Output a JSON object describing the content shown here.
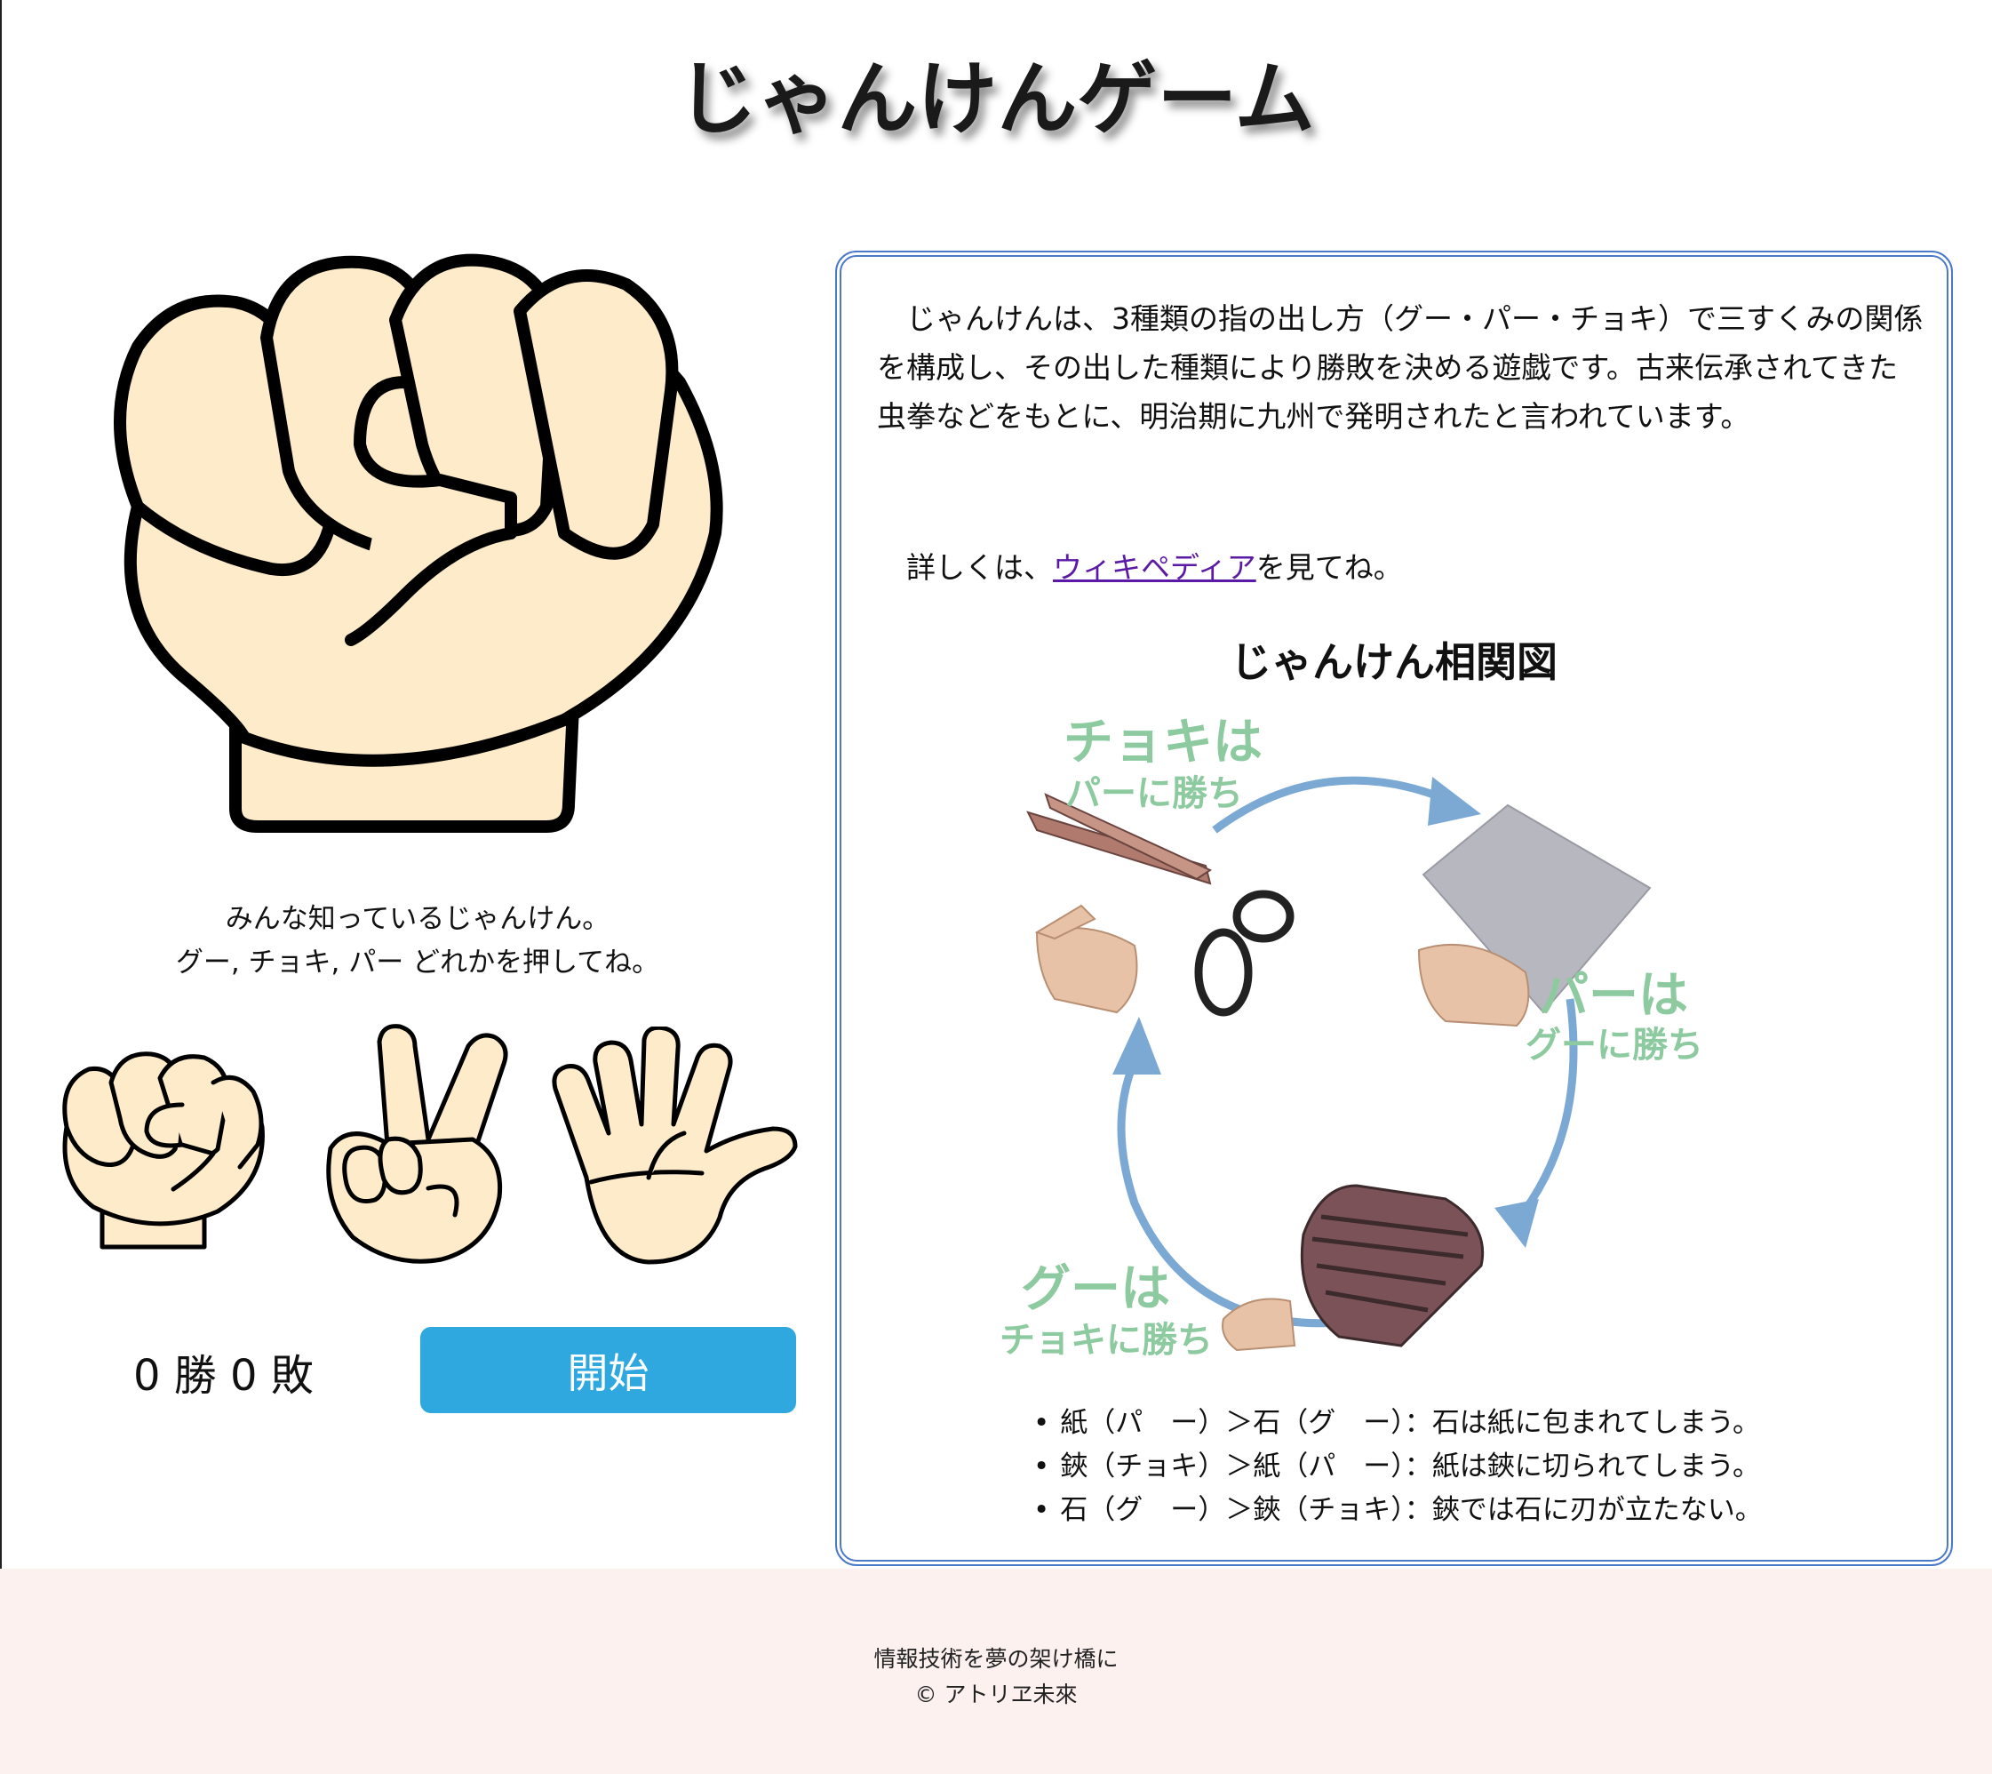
{
  "page": {
    "title": "じゃんけんゲーム"
  },
  "game": {
    "instructions": [
      "みんな知っているじゃんけん。",
      "グー, チョキ, パー どれかを押してね。"
    ],
    "hands": [
      {
        "name": "グー",
        "icon": "rock-hand-icon"
      },
      {
        "name": "チョキ",
        "icon": "scissors-hand-icon"
      },
      {
        "name": "パー",
        "icon": "paper-hand-icon"
      }
    ],
    "score": "0 勝 0 敗",
    "start_label": "開始"
  },
  "info": {
    "description": "じゃんけんは、3種類の指の出し方（グー・パー・チョキ）で三すくみの関係を構成し、その出した種類により勝敗を決める遊戯です。古来伝承されてきた虫拳などをもとに、明治期に九州で発明されたと言われています。",
    "more_prefix": "詳しくは、",
    "more_link": "ウィキペディア",
    "more_suffix": "を見てね。",
    "diagram_title": "じゃんけん相関図",
    "diagram_labels": {
      "scissors_title": "チョキは",
      "scissors_sub": "パーに勝ち",
      "paper_title": "パーは",
      "paper_sub": "グーに勝ち",
      "rock_title": "グーは",
      "rock_sub": "チョキに勝ち"
    },
    "rules": [
      "紙（パ　ー）＞石（グ　ー）：石は紙に包まれてしまう。",
      "鋏（チョキ）＞紙（パ　ー）：紙は鋏に切られてしまう。",
      "石（グ　ー）＞鋏（チョキ）：鋏では石に刃が立たない。"
    ]
  },
  "footer": {
    "tagline": "情報技術を夢の架け橋に",
    "copyright": "© アトリヱ未來"
  },
  "colors": {
    "start_button": "#2ea8df",
    "box_border": "#4a79c8",
    "skin": "#fdebc9",
    "diagram_text": "#8dcaa0",
    "arrow": "#7ba9d4",
    "footer_bg": "#fdf1ef"
  }
}
